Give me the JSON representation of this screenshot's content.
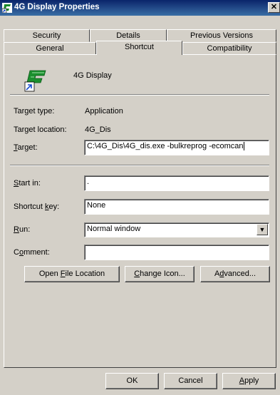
{
  "window": {
    "title": "4G Display Properties",
    "close_glyph": "✕"
  },
  "tabs": {
    "row1": [
      {
        "label": "Security"
      },
      {
        "label": "Details"
      },
      {
        "label": "Previous Versions"
      }
    ],
    "row2": [
      {
        "label": "General"
      },
      {
        "label": "Shortcut"
      },
      {
        "label": "Compatibility"
      }
    ]
  },
  "shortcut": {
    "name": "4G Display",
    "target_type_label": "Target type:",
    "target_type_value": "Application",
    "target_location_label": "Target location:",
    "target_location_value": "4G_Dis",
    "target_label_ul": "T",
    "target_label_rest": "arget:",
    "target_value": "C:\\4G_Dis\\4G_dis.exe -bulkreprog -ecomcan",
    "start_in_label_ul": "S",
    "start_in_label_rest": "tart in:",
    "start_in_value": ".",
    "shortcut_key_label_pre": "Shortcut ",
    "shortcut_key_label_ul": "k",
    "shortcut_key_label_rest": "ey:",
    "shortcut_key_value": "None",
    "run_label_ul": "R",
    "run_label_rest": "un:",
    "run_value": "Normal window",
    "comment_label_pre": "C",
    "comment_label_ul": "o",
    "comment_label_rest": "mment:",
    "comment_value": ""
  },
  "actions": {
    "open_file_pre": "Open ",
    "open_file_ul": "F",
    "open_file_rest": "ile Location",
    "change_icon_ul": "C",
    "change_icon_rest": "hange Icon...",
    "advanced_pre": "A",
    "advanced_ul": "d",
    "advanced_rest": "vanced..."
  },
  "footer": {
    "ok": "OK",
    "cancel": "Cancel",
    "apply_ul": "A",
    "apply_rest": "pply"
  },
  "icons": {
    "app": "shortcut-app-icon",
    "title": "shortcut-app-icon",
    "dropdown": "chevron-down-icon"
  }
}
